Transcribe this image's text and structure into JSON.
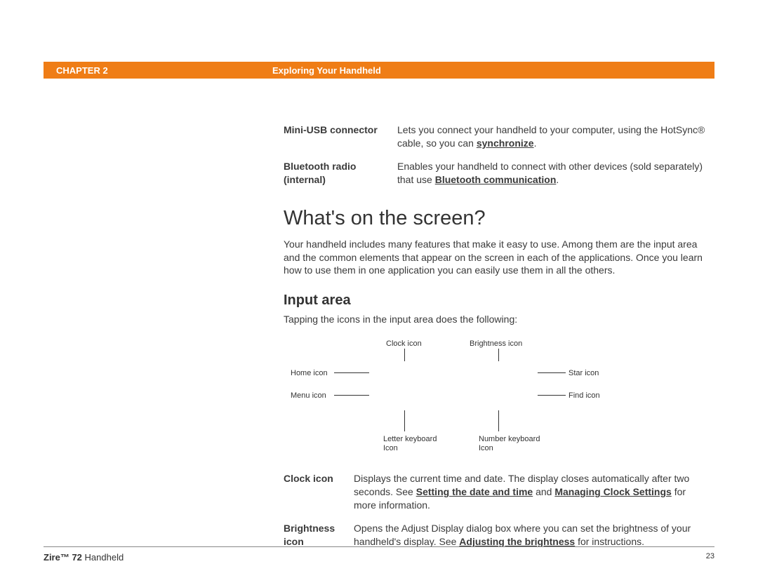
{
  "header": {
    "chapter": "CHAPTER 2",
    "title": "Exploring Your Handheld"
  },
  "defs1": [
    {
      "term": "Mini-USB connector",
      "desc_pre": "Lets you connect your handheld to your computer, using the HotSync® cable, so you can ",
      "link": "synchronize",
      "desc_post": "."
    },
    {
      "term": "Bluetooth radio (internal)",
      "desc_pre": "Enables your handheld to connect with other devices (sold separately) that use ",
      "link": "Bluetooth communication",
      "desc_post": "."
    }
  ],
  "heading1": "What's on the screen?",
  "para1": "Your handheld includes many features that make it easy to use. Among them are the input area and the common elements that appear on the screen in each of the applications. Once you learn how to use them in one application you can easily use them in all the others.",
  "heading2": "Input area",
  "para2": "Tapping the icons in the input area does the following:",
  "diagram": {
    "clock": "Clock icon",
    "brightness": "Brightness icon",
    "home": "Home icon",
    "menu": "Menu icon",
    "star": "Star icon",
    "find": "Find icon",
    "letterkb1": "Letter keyboard",
    "letterkb2": "Icon",
    "numberkb1": "Number keyboard",
    "numberkb2": "Icon"
  },
  "defs2": [
    {
      "term": "Clock icon",
      "pre": "Displays the current time and date. The display closes automatically after two seconds. See ",
      "link1": "Setting the date and time",
      "mid": " and ",
      "link2": "Managing Clock Settings",
      "post": " for more information."
    },
    {
      "term": "Brightness icon",
      "pre": "Opens the Adjust Display dialog box where you can set the brightness of your handheld's display. See ",
      "link1": "Adjusting the brightness",
      "mid": "",
      "link2": "",
      "post": " for instructions."
    }
  ],
  "footer": {
    "product_bold": "Zire™ 72",
    "product_rest": " Handheld",
    "page": "23"
  }
}
